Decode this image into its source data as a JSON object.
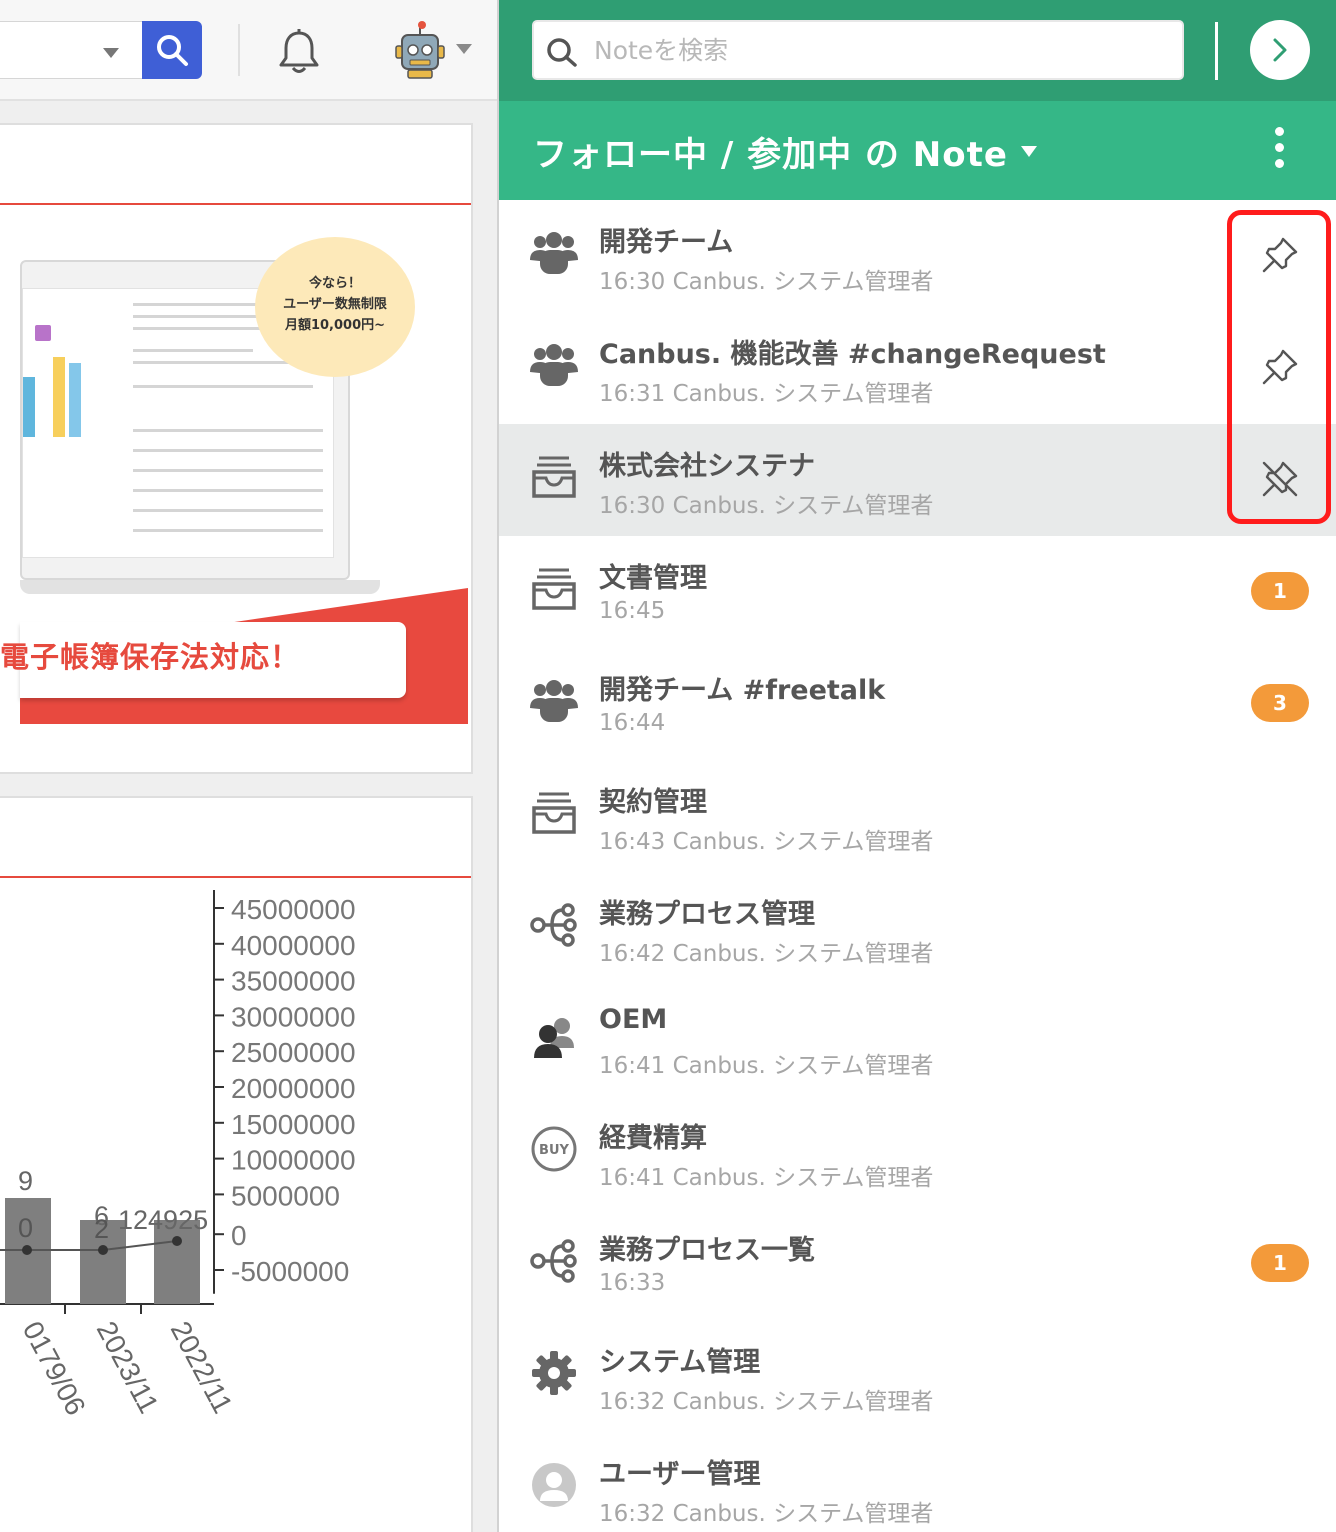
{
  "topbar": {
    "search_icon": "search-icon",
    "bell_icon": "bell-icon",
    "avatar_icon": "robot-avatar-icon"
  },
  "banner": {
    "badge_line1": "今なら！",
    "badge_line2": "ユーザー数無制限",
    "badge_line3": "月額10,000円~",
    "ribbon_text": "電子帳簿保存法対応！"
  },
  "chart_data": {
    "type": "bar",
    "categories": [
      "0179/06",
      "2023/11",
      "2022/11"
    ],
    "bar_labels": [
      "9",
      "6",
      "124925"
    ],
    "line_labels": [
      "0",
      "2",
      "0"
    ],
    "values": [
      9,
      6,
      124925
    ],
    "yaxis_ticks": [
      "45000000",
      "40000000",
      "35000000",
      "30000000",
      "25000000",
      "20000000",
      "15000000",
      "10000000",
      "5000000",
      "0",
      "-5000000"
    ],
    "ylim": [
      -5000000,
      45000000
    ],
    "grid": false,
    "colors": {
      "bar": "#7f7f7f",
      "line": "#555555"
    }
  },
  "panel": {
    "search_placeholder": "Noteを検索",
    "title": "フォロー中 / 参加中 の Note",
    "colors": {
      "header": "#2f9e73",
      "title_bar": "#35b787",
      "badge": "#f39a3a",
      "annotation": "#ff1c1c"
    },
    "notes": [
      {
        "name": "開発チーム",
        "meta": "16:30 Canbus. システム管理者",
        "icon": "group-icon",
        "pin": "pin-icon",
        "active": false
      },
      {
        "name": "Canbus. 機能改善 #changeRequest",
        "meta": "16:31 Canbus. システム管理者",
        "icon": "group-icon",
        "pin": "pin-icon",
        "active": false
      },
      {
        "name": "株式会社システナ",
        "meta": "16:30 Canbus. システム管理者",
        "icon": "inbox-tray-icon",
        "pin": "unpin-icon",
        "active": true
      },
      {
        "name": "文書管理",
        "meta": "16:45",
        "icon": "inbox-tray-icon",
        "badge": "1"
      },
      {
        "name": "開発チーム #freetalk",
        "meta": "16:44",
        "icon": "group-icon",
        "badge": "3"
      },
      {
        "name": "契約管理",
        "meta": "16:43 Canbus. システム管理者",
        "icon": "inbox-tray-icon"
      },
      {
        "name": "業務プロセス管理",
        "meta": "16:42 Canbus. システム管理者",
        "icon": "workflow-icon"
      },
      {
        "name": "OEM",
        "meta": "16:41 Canbus. システム管理者",
        "icon": "partner-users-icon"
      },
      {
        "name": "経費精算",
        "meta": "16:41 Canbus. システム管理者",
        "icon": "buy-icon"
      },
      {
        "name": "業務プロセス一覧",
        "meta": "16:33",
        "icon": "workflow-icon",
        "badge": "1"
      },
      {
        "name": "システム管理",
        "meta": "16:32 Canbus. システム管理者",
        "icon": "gear-icon"
      },
      {
        "name": "ユーザー管理",
        "meta": "16:32 Canbus. システム管理者",
        "icon": "user-avatar-icon"
      }
    ]
  }
}
